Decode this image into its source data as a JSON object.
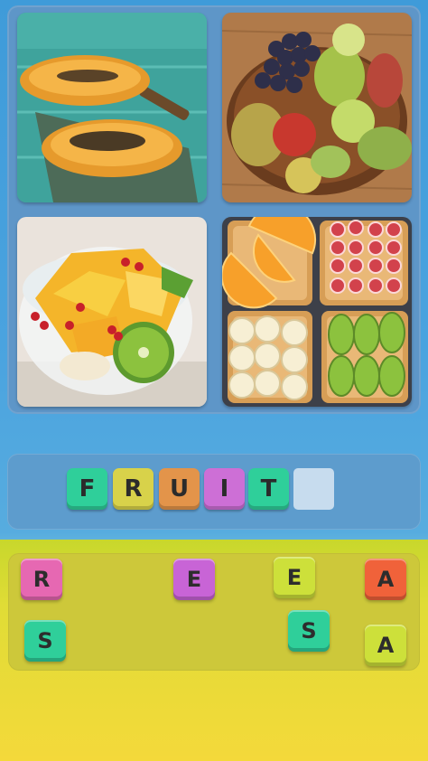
{
  "puzzle": {
    "images": [
      {
        "icon": "papaya-photo-icon"
      },
      {
        "icon": "fruit-bowl-photo-icon"
      },
      {
        "icon": "fruit-salad-photo-icon"
      },
      {
        "icon": "fruit-toast-photo-icon"
      }
    ]
  },
  "answer": {
    "slots": [
      {
        "letter": "F",
        "color": "#2fcf9a"
      },
      {
        "letter": "R",
        "color": "#d8d24a"
      },
      {
        "letter": "U",
        "color": "#e3944a"
      },
      {
        "letter": "I",
        "color": "#cd6fd6"
      },
      {
        "letter": "T",
        "color": "#2fcf9a"
      },
      {
        "letter": "",
        "color": "#c7dcee"
      }
    ]
  },
  "letter_bank": [
    {
      "letter": "R",
      "color": "#e668b2"
    },
    {
      "letter": "E",
      "color": "#c864d6"
    },
    {
      "letter": "E",
      "color": "#cde03a"
    },
    {
      "letter": "A",
      "color": "#f0623a"
    },
    {
      "letter": "S",
      "color": "#2fcf9a"
    },
    {
      "letter": "S",
      "color": "#2fcf9a"
    },
    {
      "letter": "A",
      "color": "#cde03a"
    }
  ]
}
